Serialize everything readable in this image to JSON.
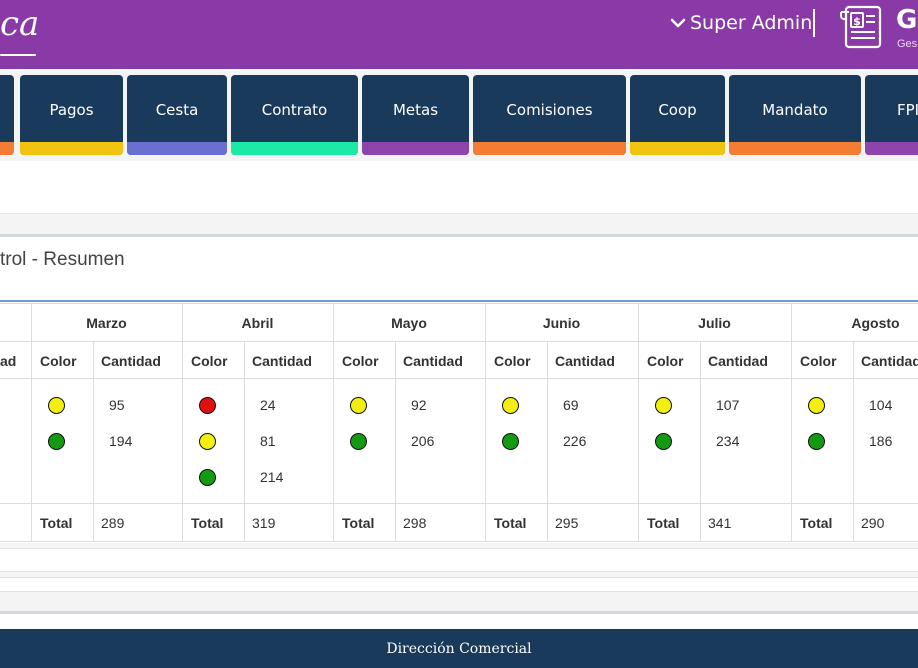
{
  "header": {
    "logo_text": "ca",
    "user_label": "Super Admin",
    "app_short": "G",
    "app_sub": "Ges"
  },
  "nav": {
    "tabs": [
      {
        "label": "",
        "bar_color": "#f57c33"
      },
      {
        "label": "Pagos",
        "bar_color": "#f1c40f"
      },
      {
        "label": "Cesta",
        "bar_color": "#6a6fd0"
      },
      {
        "label": "Contrato",
        "bar_color": "#1de9a6"
      },
      {
        "label": "Metas",
        "bar_color": "#8e44ad"
      },
      {
        "label": "Comisiones",
        "bar_color": "#f57c33"
      },
      {
        "label": "Coop",
        "bar_color": "#f1c40f"
      },
      {
        "label": "Mandato",
        "bar_color": "#f57c33"
      },
      {
        "label": "FPI",
        "bar_color": "#8e44ad"
      }
    ]
  },
  "summary": {
    "title": "trol - Resumen",
    "prev_column_partial": "ad",
    "color_header": "Color",
    "qty_header": "Cantidad",
    "total_label": "Total",
    "status_colors": {
      "red": "#e01010",
      "yellow": "#f2ee10",
      "green": "#139a13"
    },
    "months": [
      {
        "name": "Marzo",
        "rows": [
          {
            "color": "yellow",
            "qty": "95"
          },
          {
            "color": "green",
            "qty": "194"
          }
        ],
        "total": "289"
      },
      {
        "name": "Abril",
        "rows": [
          {
            "color": "red",
            "qty": "24"
          },
          {
            "color": "yellow",
            "qty": "81"
          },
          {
            "color": "green",
            "qty": "214"
          }
        ],
        "total": "319"
      },
      {
        "name": "Mayo",
        "rows": [
          {
            "color": "yellow",
            "qty": "92"
          },
          {
            "color": "green",
            "qty": "206"
          }
        ],
        "total": "298"
      },
      {
        "name": "Junio",
        "rows": [
          {
            "color": "yellow",
            "qty": "69"
          },
          {
            "color": "green",
            "qty": "226"
          }
        ],
        "total": "295"
      },
      {
        "name": "Julio",
        "rows": [
          {
            "color": "yellow",
            "qty": "107"
          },
          {
            "color": "green",
            "qty": "234"
          }
        ],
        "total": "341"
      },
      {
        "name": "Agosto",
        "rows": [
          {
            "color": "yellow",
            "qty": "104"
          },
          {
            "color": "green",
            "qty": "186"
          }
        ],
        "total": "290"
      }
    ]
  },
  "footer": {
    "text": "Dirección Comercial"
  }
}
